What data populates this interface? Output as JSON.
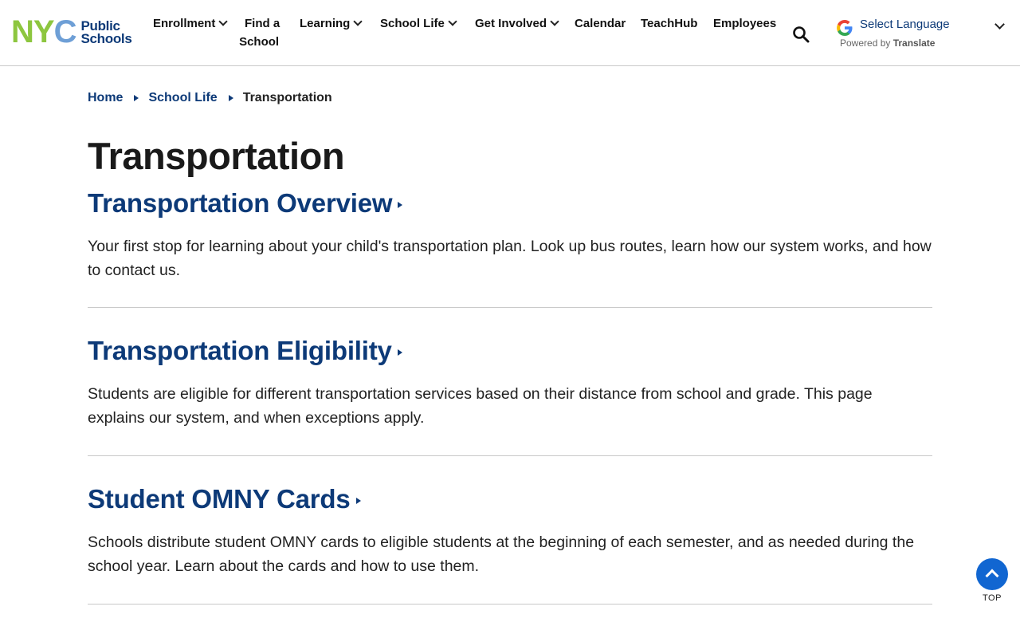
{
  "header": {
    "logo": {
      "nyc": "NYC",
      "line1": "Public",
      "line2": "Schools"
    },
    "nav": [
      {
        "label": "Enrollment",
        "dropdown": true
      },
      {
        "label": "Find a",
        "label2": "School",
        "dropdown": false
      },
      {
        "label": "Learning",
        "dropdown": true
      },
      {
        "label": "School Life",
        "dropdown": true
      },
      {
        "label": "Get Involved",
        "dropdown": true
      },
      {
        "label": "Calendar",
        "dropdown": false
      },
      {
        "label": "TeachHub",
        "dropdown": false
      },
      {
        "label": "Employees",
        "dropdown": false
      }
    ],
    "language": {
      "select_label": "Select Language",
      "powered_by": "Powered by",
      "translate": "Translate"
    }
  },
  "breadcrumb": [
    {
      "label": "Home"
    },
    {
      "label": "School Life"
    },
    {
      "label": "Transportation"
    }
  ],
  "page_title": "Transportation",
  "sections": [
    {
      "title": "Transportation Overview",
      "description": "Your first stop for learning about your child's transportation plan. Look up bus routes, learn how our system works, and how to contact us."
    },
    {
      "title": "Transportation Eligibility",
      "description": "Students are eligible for different transportation services based on their distance from school and grade. This page explains our system, and when exceptions apply."
    },
    {
      "title": "Student OMNY Cards",
      "description": "Schools distribute student OMNY cards to eligible students at the beginning of each semester, and as needed during the school year. Learn about the cards and how to use them."
    }
  ],
  "back_to_top": {
    "label": "TOP"
  },
  "colors": {
    "brand_navy": "#0d3a78",
    "logo_green": "#8dc63f",
    "logo_blue": "#6e9fd6",
    "top_button": "#1166d1"
  }
}
